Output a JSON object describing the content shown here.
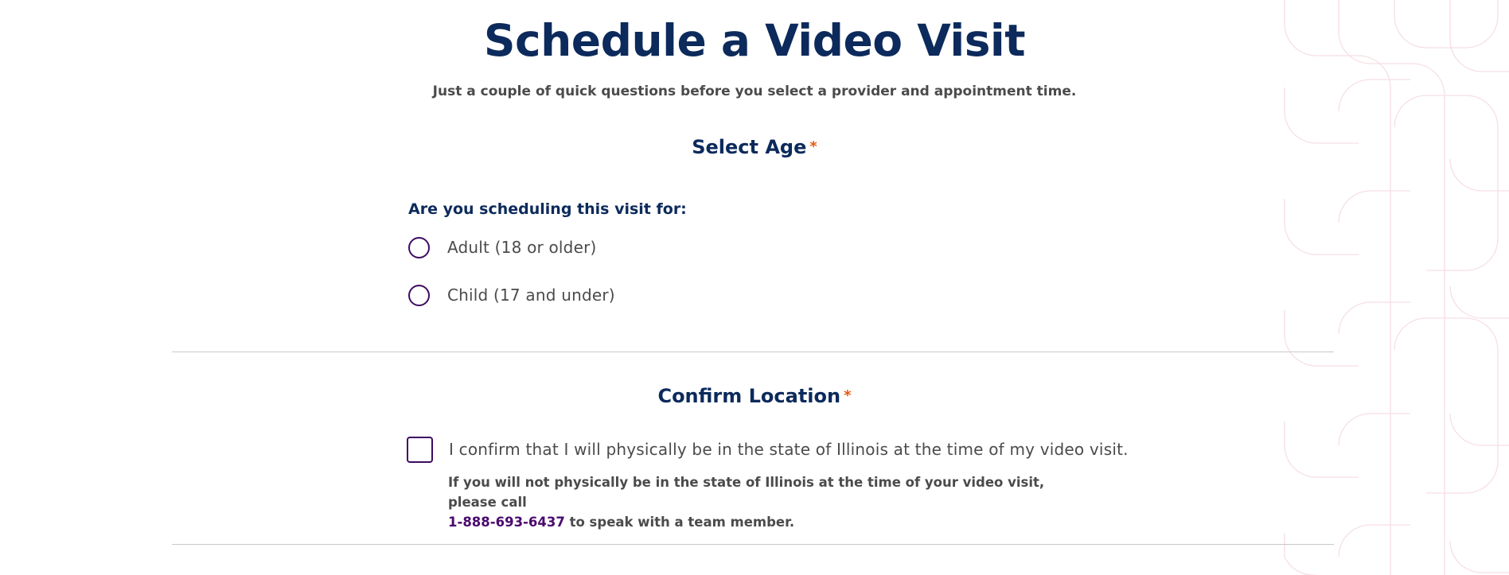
{
  "header": {
    "title": "Schedule a Video Visit",
    "subtitle": "Just a couple of quick questions before you select a provider and appointment time."
  },
  "age_section": {
    "heading": "Select Age",
    "required_mark": "*",
    "question": "Are you scheduling this visit for:",
    "options": [
      {
        "label": "Adult (18 or older)",
        "selected": false
      },
      {
        "label": "Child (17 and under)",
        "selected": false
      }
    ]
  },
  "location_section": {
    "heading": "Confirm Location",
    "required_mark": "*",
    "checkbox_label": "I confirm that I will physically be in the state of Illinois at the time of my video visit.",
    "checked": false,
    "note_before": "If you will not physically be in the state of Illinois at the time of your video visit, please call",
    "phone": "1-888-693-6437",
    "note_after": " to speak with a team member."
  },
  "colors": {
    "heading": "#0c2a5b",
    "body_text": "#4b4b4b",
    "accent_purple": "#3d0b61",
    "required_orange": "#e8590c",
    "divider": "#c9c9c9"
  }
}
